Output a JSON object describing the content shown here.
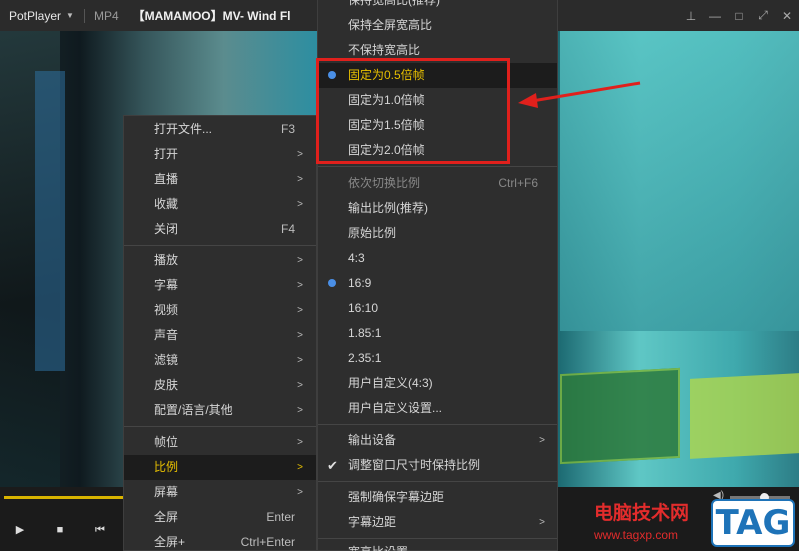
{
  "titlebar": {
    "app_name": "PotPlayer",
    "format": "MP4",
    "title": "【MAMAMOO】MV- Wind Fl",
    "controls": [
      "pin-icon",
      "minimize-icon",
      "maximize-icon",
      "fullscreen-icon",
      "close-icon"
    ]
  },
  "main_menu": [
    {
      "label": "打开文件...",
      "shortcut": "F3"
    },
    {
      "label": "打开",
      "arrow": ">"
    },
    {
      "label": "直播",
      "arrow": ">"
    },
    {
      "label": "收藏",
      "arrow": ">"
    },
    {
      "label": "关闭",
      "shortcut": "F4"
    },
    {
      "label": "播放",
      "arrow": ">"
    },
    {
      "label": "字幕",
      "arrow": ">"
    },
    {
      "label": "视频",
      "arrow": ">"
    },
    {
      "label": "声音",
      "arrow": ">"
    },
    {
      "label": "滤镜",
      "arrow": ">"
    },
    {
      "label": "皮肤",
      "arrow": ">"
    },
    {
      "label": "配置/语言/其他",
      "arrow": ">"
    },
    {
      "label": "帧位",
      "arrow": ">"
    },
    {
      "label": "比例",
      "arrow": ">"
    },
    {
      "label": "屏幕",
      "arrow": ">"
    },
    {
      "label": "全屏",
      "shortcut": "Enter"
    },
    {
      "label": "全屏+",
      "shortcut": "Ctrl+Enter"
    }
  ],
  "submenu": [
    {
      "label": "保持宽高比(推荐)"
    },
    {
      "label": "保持全屏宽高比"
    },
    {
      "label": "不保持宽高比"
    },
    {
      "label": "固定为0.5倍帧"
    },
    {
      "label": "固定为1.0倍帧"
    },
    {
      "label": "固定为1.5倍帧"
    },
    {
      "label": "固定为2.0倍帧"
    },
    {
      "label": "依次切换比例",
      "shortcut": "Ctrl+F6"
    },
    {
      "label": "输出比例(推荐)"
    },
    {
      "label": "原始比例"
    },
    {
      "label": "4:3"
    },
    {
      "label": "16:9"
    },
    {
      "label": "16:10"
    },
    {
      "label": "1.85:1"
    },
    {
      "label": "2.35:1"
    },
    {
      "label": "用户自定义(4:3)"
    },
    {
      "label": "用户自定义设置..."
    },
    {
      "label": "输出设备",
      "arrow": ">"
    },
    {
      "label": "调整窗口尺寸时保持比例"
    },
    {
      "label": "强制确保字幕边距"
    },
    {
      "label": "字幕边距",
      "arrow": ">"
    },
    {
      "label": "宽高比设置..."
    }
  ],
  "watermark": {
    "site_name": "电脑技术网",
    "url": "www.tagxp.com",
    "tag": "TAG"
  },
  "colors": {
    "accent": "#e8c000",
    "radio": "#4a8fe6",
    "annotation": "#e0201c"
  }
}
